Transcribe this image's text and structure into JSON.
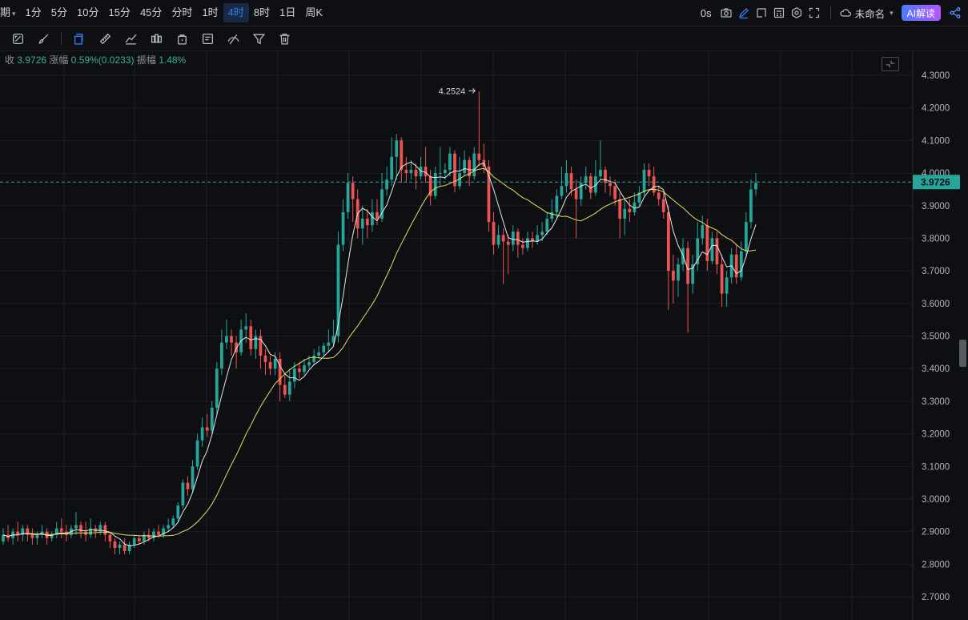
{
  "toolbar": {
    "period_prefix": "期",
    "periods": [
      {
        "label": "1分"
      },
      {
        "label": "5分"
      },
      {
        "label": "10分"
      },
      {
        "label": "15分"
      },
      {
        "label": "45分"
      },
      {
        "label": "分时"
      },
      {
        "label": "1时"
      },
      {
        "label": "4时",
        "active": true
      },
      {
        "label": "8时"
      },
      {
        "label": "1日"
      },
      {
        "label": "周K"
      }
    ],
    "timer": "0s",
    "layout_name": "未命名",
    "ai_button": "AI解读"
  },
  "info": {
    "close_label": "收",
    "close_value": "3.9726",
    "change_label": "涨幅",
    "change_value": "0.59%(0.0233)",
    "amplitude_label": "振幅",
    "amplitude_value": "1.48%"
  },
  "colors": {
    "up": "#26a69a",
    "down": "#ef5350",
    "ma_fast": "#e6e6e6",
    "ma_slow": "#e8e061",
    "price_line": "#26a69a",
    "accent": "#2f7cf6"
  },
  "chart_data": {
    "type": "candlestick",
    "y_axis": {
      "ticks": [
        "4.3000",
        "4.2000",
        "4.1000",
        "4.0000",
        "3.9000",
        "3.8000",
        "3.7000",
        "3.6000",
        "3.5000",
        "3.4000",
        "3.3000",
        "3.2000",
        "3.1000",
        "3.0000",
        "2.9000",
        "2.8000",
        "2.7000"
      ],
      "range": [
        2.66,
        4.34
      ]
    },
    "current_price": "3.9726",
    "high_marker": "4.2524",
    "candles": [
      [
        2.87,
        2.89,
        2.91,
        2.86
      ],
      [
        2.89,
        2.88,
        2.92,
        2.87
      ],
      [
        2.88,
        2.9,
        2.91,
        2.86
      ],
      [
        2.9,
        2.89,
        2.93,
        2.87
      ],
      [
        2.89,
        2.91,
        2.92,
        2.87
      ],
      [
        2.91,
        2.89,
        2.92,
        2.87
      ],
      [
        2.89,
        2.88,
        2.91,
        2.86
      ],
      [
        2.88,
        2.89,
        2.9,
        2.86
      ],
      [
        2.89,
        2.9,
        2.92,
        2.88
      ],
      [
        2.9,
        2.88,
        2.91,
        2.86
      ],
      [
        2.88,
        2.89,
        2.9,
        2.87
      ],
      [
        2.89,
        2.91,
        2.93,
        2.88
      ],
      [
        2.91,
        2.9,
        2.94,
        2.88
      ],
      [
        2.9,
        2.89,
        2.92,
        2.87
      ],
      [
        2.89,
        2.91,
        2.92,
        2.88
      ],
      [
        2.91,
        2.92,
        2.96,
        2.89
      ],
      [
        2.92,
        2.9,
        2.93,
        2.88
      ],
      [
        2.9,
        2.89,
        2.93,
        2.87
      ],
      [
        2.89,
        2.91,
        2.94,
        2.88
      ],
      [
        2.91,
        2.9,
        2.92,
        2.88
      ],
      [
        2.9,
        2.92,
        2.93,
        2.89
      ],
      [
        2.92,
        2.89,
        2.93,
        2.87
      ],
      [
        2.89,
        2.87,
        2.9,
        2.85
      ],
      [
        2.87,
        2.85,
        2.88,
        2.83
      ],
      [
        2.85,
        2.86,
        2.87,
        2.83
      ],
      [
        2.86,
        2.84,
        2.88,
        2.83
      ],
      [
        2.84,
        2.86,
        2.87,
        2.83
      ],
      [
        2.86,
        2.88,
        2.89,
        2.85
      ],
      [
        2.88,
        2.87,
        2.89,
        2.86
      ],
      [
        2.87,
        2.89,
        2.9,
        2.86
      ],
      [
        2.89,
        2.88,
        2.91,
        2.87
      ],
      [
        2.88,
        2.9,
        2.91,
        2.87
      ],
      [
        2.9,
        2.89,
        2.92,
        2.88
      ],
      [
        2.89,
        2.91,
        2.92,
        2.88
      ],
      [
        2.91,
        2.92,
        2.94,
        2.9
      ],
      [
        2.92,
        2.94,
        2.95,
        2.91
      ],
      [
        2.94,
        2.98,
        2.99,
        2.93
      ],
      [
        2.98,
        3.05,
        3.06,
        2.97
      ],
      [
        3.05,
        3.03,
        3.07,
        3.01
      ],
      [
        3.03,
        3.1,
        3.12,
        3.02
      ],
      [
        3.1,
        3.18,
        3.2,
        3.09
      ],
      [
        3.18,
        3.22,
        3.25,
        3.16
      ],
      [
        3.22,
        3.21,
        3.26,
        3.19
      ],
      [
        3.21,
        3.28,
        3.3,
        3.2
      ],
      [
        3.28,
        3.4,
        3.42,
        3.26
      ],
      [
        3.4,
        3.48,
        3.52,
        3.38
      ],
      [
        3.48,
        3.5,
        3.55,
        3.46
      ],
      [
        3.5,
        3.48,
        3.52,
        3.44
      ],
      [
        3.48,
        3.45,
        3.5,
        3.4
      ],
      [
        3.45,
        3.52,
        3.55,
        3.44
      ],
      [
        3.52,
        3.53,
        3.57,
        3.48
      ],
      [
        3.53,
        3.46,
        3.55,
        3.44
      ],
      [
        3.46,
        3.5,
        3.52,
        3.43
      ],
      [
        3.5,
        3.44,
        3.52,
        3.4
      ],
      [
        3.44,
        3.42,
        3.46,
        3.38
      ],
      [
        3.42,
        3.4,
        3.44,
        3.38
      ],
      [
        3.4,
        3.43,
        3.45,
        3.38
      ],
      [
        3.43,
        3.35,
        3.45,
        3.3
      ],
      [
        3.35,
        3.32,
        3.38,
        3.31
      ],
      [
        3.32,
        3.36,
        3.4,
        3.3
      ],
      [
        3.36,
        3.4,
        3.42,
        3.34
      ],
      [
        3.4,
        3.39,
        3.42,
        3.37
      ],
      [
        3.39,
        3.41,
        3.43,
        3.38
      ],
      [
        3.41,
        3.42,
        3.44,
        3.4
      ],
      [
        3.42,
        3.44,
        3.46,
        3.41
      ],
      [
        3.44,
        3.45,
        3.47,
        3.43
      ],
      [
        3.45,
        3.47,
        3.48,
        3.44
      ],
      [
        3.47,
        3.48,
        3.52,
        3.45
      ],
      [
        3.48,
        3.5,
        3.55,
        3.47
      ],
      [
        3.5,
        3.78,
        3.82,
        3.48
      ],
      [
        3.78,
        3.88,
        3.92,
        3.76
      ],
      [
        3.88,
        3.97,
        4.0,
        3.86
      ],
      [
        3.97,
        3.92,
        3.99,
        3.85
      ],
      [
        3.92,
        3.83,
        3.95,
        3.8
      ],
      [
        3.83,
        3.86,
        3.9,
        3.78
      ],
      [
        3.86,
        3.84,
        3.89,
        3.8
      ],
      [
        3.84,
        3.88,
        3.92,
        3.82
      ],
      [
        3.88,
        3.86,
        3.92,
        3.84
      ],
      [
        3.86,
        3.95,
        4.0,
        3.85
      ],
      [
        3.95,
        3.98,
        4.02,
        3.93
      ],
      [
        3.98,
        4.05,
        4.11,
        3.96
      ],
      [
        4.05,
        4.1,
        4.12,
        3.98
      ],
      [
        4.1,
        4.01,
        4.11,
        3.97
      ],
      [
        4.01,
        4.0,
        4.05,
        3.97
      ],
      [
        4.0,
        4.01,
        4.04,
        3.98
      ],
      [
        4.01,
        3.99,
        4.03,
        3.95
      ],
      [
        3.99,
        4.02,
        4.05,
        3.98
      ],
      [
        4.02,
        3.99,
        4.08,
        3.97
      ],
      [
        3.99,
        3.93,
        4.01,
        3.9
      ],
      [
        3.93,
        4.0,
        4.02,
        3.92
      ],
      [
        4.0,
        4.0,
        4.08,
        3.96
      ],
      [
        4.0,
        4.01,
        4.03,
        3.98
      ],
      [
        4.01,
        4.06,
        4.08,
        3.99
      ],
      [
        4.06,
        3.96,
        4.07,
        3.94
      ],
      [
        3.96,
        4.0,
        4.05,
        3.95
      ],
      [
        4.0,
        4.04,
        4.07,
        3.99
      ],
      [
        4.04,
        3.99,
        4.05,
        3.96
      ],
      [
        3.99,
        4.06,
        4.08,
        3.98
      ],
      [
        4.06,
        4.04,
        4.25,
        4.02
      ],
      [
        4.04,
        4.02,
        4.09,
        4.0
      ],
      [
        4.02,
        3.85,
        4.04,
        3.82
      ],
      [
        3.85,
        3.78,
        3.88,
        3.75
      ],
      [
        3.78,
        3.81,
        3.84,
        3.77
      ],
      [
        3.81,
        3.79,
        3.83,
        3.66
      ],
      [
        3.79,
        3.78,
        3.81,
        3.69
      ],
      [
        3.78,
        3.82,
        3.84,
        3.76
      ],
      [
        3.82,
        3.78,
        3.83,
        3.74
      ],
      [
        3.78,
        3.77,
        3.8,
        3.75
      ],
      [
        3.77,
        3.8,
        3.82,
        3.76
      ],
      [
        3.8,
        3.79,
        3.82,
        3.77
      ],
      [
        3.79,
        3.81,
        3.84,
        3.78
      ],
      [
        3.81,
        3.82,
        3.85,
        3.79
      ],
      [
        3.82,
        3.86,
        3.88,
        3.81
      ],
      [
        3.86,
        3.88,
        3.92,
        3.85
      ],
      [
        3.88,
        3.93,
        3.95,
        3.86
      ],
      [
        3.93,
        3.96,
        4.02,
        3.92
      ],
      [
        3.96,
        4.0,
        4.04,
        3.94
      ],
      [
        4.0,
        3.95,
        4.02,
        3.93
      ],
      [
        3.95,
        3.92,
        3.98,
        3.8
      ],
      [
        3.92,
        3.97,
        3.99,
        3.9
      ],
      [
        3.97,
        3.99,
        4.02,
        3.95
      ],
      [
        3.99,
        3.94,
        4.0,
        3.92
      ],
      [
        3.94,
        3.99,
        4.04,
        3.93
      ],
      [
        3.99,
        4.01,
        4.1,
        3.98
      ],
      [
        4.01,
        3.97,
        4.02,
        3.94
      ],
      [
        3.97,
        3.96,
        3.99,
        3.93
      ],
      [
        3.96,
        3.92,
        3.98,
        3.9
      ],
      [
        3.92,
        3.86,
        3.94,
        3.8
      ],
      [
        3.86,
        3.89,
        3.92,
        3.81
      ],
      [
        3.89,
        3.88,
        3.92,
        3.85
      ],
      [
        3.88,
        3.91,
        3.94,
        3.87
      ],
      [
        3.91,
        3.94,
        3.96,
        3.9
      ],
      [
        3.94,
        4.01,
        4.03,
        3.93
      ],
      [
        4.01,
        3.99,
        4.03,
        3.96
      ],
      [
        3.99,
        3.94,
        4.02,
        3.93
      ],
      [
        3.94,
        3.92,
        3.96,
        3.9
      ],
      [
        3.92,
        3.88,
        3.94,
        3.86
      ],
      [
        3.88,
        3.7,
        3.9,
        3.58
      ],
      [
        3.7,
        3.67,
        3.75,
        3.6
      ],
      [
        3.67,
        3.72,
        3.74,
        3.62
      ],
      [
        3.72,
        3.77,
        3.8,
        3.7
      ],
      [
        3.77,
        3.66,
        3.79,
        3.51
      ],
      [
        3.66,
        3.72,
        3.75,
        3.63
      ],
      [
        3.72,
        3.8,
        3.85,
        3.7
      ],
      [
        3.8,
        3.84,
        3.87,
        3.78
      ],
      [
        3.84,
        3.73,
        3.86,
        3.7
      ],
      [
        3.73,
        3.8,
        3.82,
        3.72
      ],
      [
        3.8,
        3.72,
        3.82,
        3.69
      ],
      [
        3.72,
        3.63,
        3.75,
        3.59
      ],
      [
        3.63,
        3.68,
        3.7,
        3.59
      ],
      [
        3.68,
        3.75,
        3.77,
        3.66
      ],
      [
        3.75,
        3.68,
        3.78,
        3.66
      ],
      [
        3.68,
        3.76,
        3.79,
        3.67
      ],
      [
        3.76,
        3.85,
        3.88,
        3.74
      ],
      [
        3.85,
        3.95,
        3.98,
        3.83
      ],
      [
        3.95,
        3.97,
        4.0,
        3.93
      ]
    ]
  }
}
